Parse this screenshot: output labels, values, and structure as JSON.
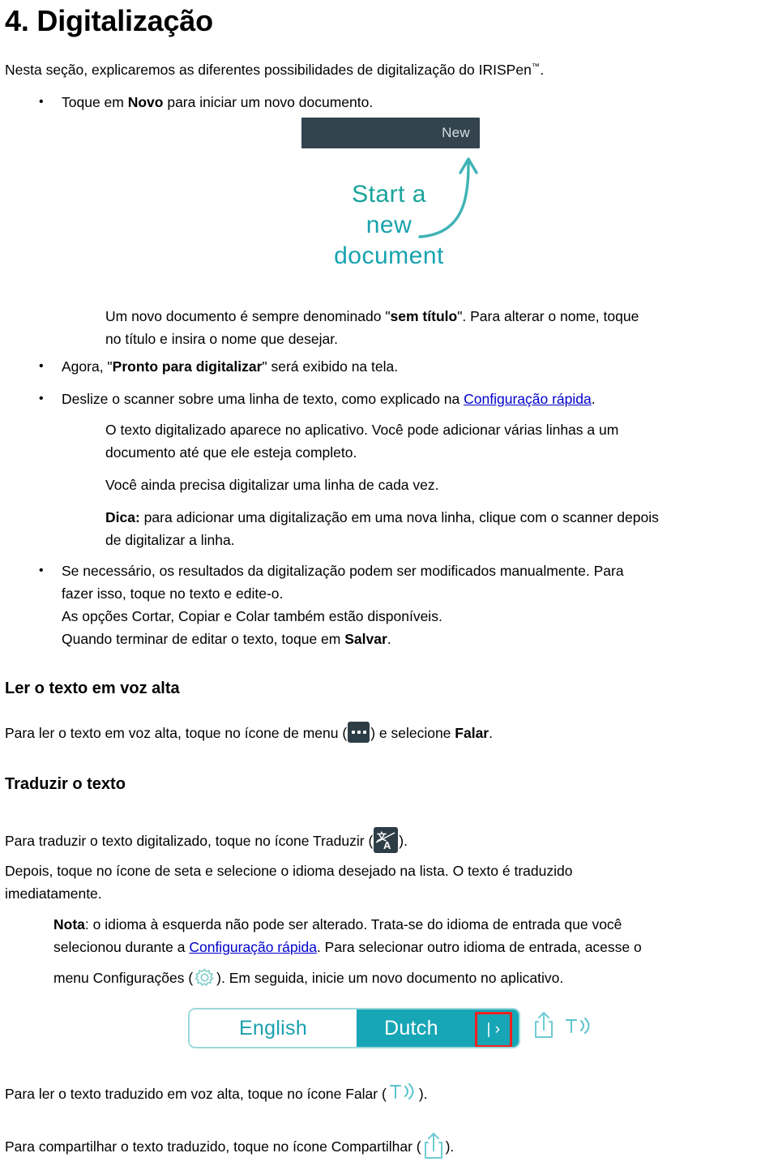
{
  "document": {
    "heading": "4. Digitalização",
    "intro_before_tm": "Nesta seção, explicaremos as diferentes possibilidades de digitalização do IRISPen",
    "intro_tm": "™",
    "intro_after_tm": "."
  },
  "bullets": {
    "b1_before": "Toque em ",
    "b1_bold": "Novo",
    "b1_after": " para iniciar um novo documento.",
    "b2_line1_before": "Um novo documento é sempre denominado \"",
    "b2_line1_bold": "sem título",
    "b2_line1_after": "\". Para alterar o nome, toque",
    "b2_line2": "no título e insira o nome que desejar.",
    "b3_before": "Agora, \"",
    "b3_bold": "Pronto para digitalizar",
    "b3_after": "\" será exibido na tela.",
    "b4_before": "Deslize o scanner sobre uma linha de texto, como explicado na ",
    "b4_link": "Configuração rápida",
    "b4_after": ".",
    "p1_line1": "O texto digitalizado aparece no aplicativo. Você pode adicionar várias linhas a um",
    "p1_line2": "documento até que ele esteja completo.",
    "p2": "Você ainda precisa digitalizar uma linha de cada vez.",
    "p3_bold": "Dica:",
    "p3_line1_after": " para adicionar uma digitalização em uma nova linha, clique com o scanner depois",
    "p3_line2": "de digitalizar a linha.",
    "b5_line1": "Se necessário, os resultados da digitalização podem ser modificados manualmente. Para",
    "b5_line2": "fazer isso, toque no texto e edite-o.",
    "b5_line3": "As opções Cortar, Copiar e Colar também estão disponíveis.",
    "b5_line4_before": "Quando terminar de editar o texto, toque em ",
    "b5_line4_bold": "Salvar",
    "b5_line4_after": "."
  },
  "figure_new": {
    "button_label": "New",
    "caption_line1": "Start a",
    "caption_line2": "new",
    "caption_line3": "document"
  },
  "section_read_aloud": {
    "heading": "Ler o texto em voz alta",
    "text_before_icon": "Para ler o texto em voz alta, toque no ícone de menu (",
    "text_after_icon": ") e selecione ",
    "text_bold": "Falar",
    "text_end": "."
  },
  "section_translate": {
    "heading": "Traduzir o texto",
    "line1_before_icon": "Para traduzir o texto digitalizado, toque no ícone Traduzir (",
    "line1_after_icon": ").",
    "line2a": "Depois, toque no ícone de seta e selecione o idioma desejado na lista. O texto é traduzido",
    "line2b": "imediatamente.",
    "note_bold": "Nota",
    "note_line1_after": ": o idioma à esquerda não pode ser alterado. Trata-se do idioma de entrada que você",
    "note_line2_before": "selecionou durante a ",
    "note_line2_link": "Configuração rápida",
    "note_line2_after": ". Para selecionar outro idioma de entrada, acesse o",
    "note_line3_before": "menu Configurações (",
    "note_line3_after": "). Em seguida, inicie um novo documento no aplicativo."
  },
  "figure_language": {
    "source_language": "English",
    "target_language": "Dutch",
    "chevron": "›",
    "divider": "|"
  },
  "footer": {
    "speak_before": "Para ler o texto traduzido em voz alta, toque no ícone Falar (",
    "speak_after": ").",
    "share_before": "Para compartilhar o texto traduzido, toque no ícone Compartilhar (",
    "share_after": ")."
  },
  "colors": {
    "teal": "#17a6b5",
    "teal_light": "#9ed8dc",
    "dark_navy": "#33444e",
    "link_blue": "#0000cc",
    "highlight_red": "#ee2222"
  }
}
